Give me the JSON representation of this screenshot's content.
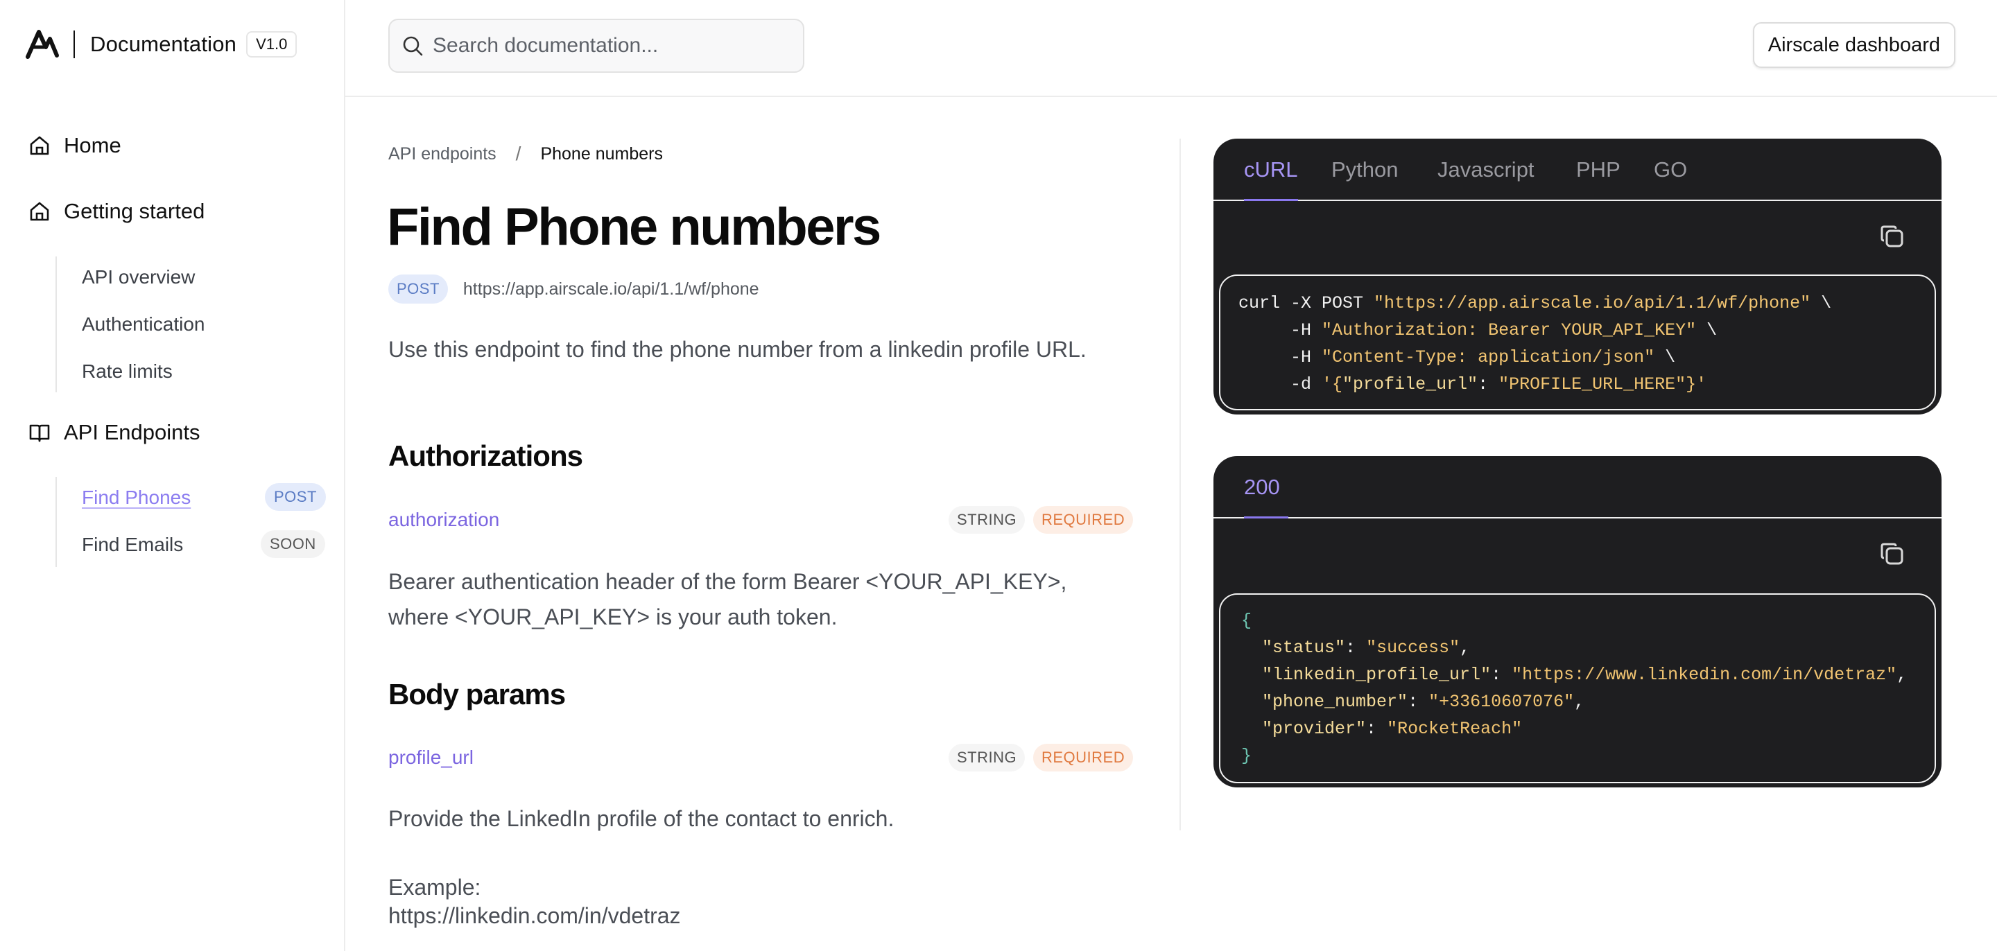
{
  "brand": {
    "title": "Documentation",
    "version": "V1.0"
  },
  "search": {
    "placeholder": "Search documentation..."
  },
  "topbar": {
    "dashboard_label": "Airscale dashboard"
  },
  "sidebar": {
    "home": "Home",
    "getting_started": "Getting started",
    "getting_started_items": [
      "API overview",
      "Authentication",
      "Rate limits"
    ],
    "api_endpoints": "API Endpoints",
    "endpoint_items": [
      {
        "label": "Find Phones",
        "badge": "POST",
        "active": true
      },
      {
        "label": "Find Emails",
        "badge": "SOON",
        "active": false
      }
    ]
  },
  "breadcrumb": {
    "parent": "API endpoints",
    "separator": "/",
    "current": "Phone numbers"
  },
  "page": {
    "title": "Find Phone numbers",
    "method": "POST",
    "url": "https://app.airscale.io/api/1.1/wf/phone",
    "description": "Use this endpoint to find the phone number from a linkedin profile URL."
  },
  "authorizations": {
    "heading": "Authorizations",
    "param": "authorization",
    "type": "STRING",
    "required": "REQUIRED",
    "description": "Bearer authentication header of the form Bearer <YOUR_API_KEY>, where <YOUR_API_KEY> is your auth token."
  },
  "body_params": {
    "heading": "Body params",
    "param": "profile_url",
    "type": "STRING",
    "required": "REQUIRED",
    "description": "Provide the LinkedIn profile of the contact to enrich.",
    "example_label": "Example:",
    "example_value": "https://linkedin.com/in/vdetraz"
  },
  "request_panel": {
    "tabs": [
      "cURL",
      "Python",
      "Javascript",
      "PHP",
      "GO"
    ],
    "active_tab": "cURL",
    "code": {
      "l1_cmd": "curl -X POST ",
      "l1_url": "\"https://app.airscale.io/api/1.1/wf/phone\"",
      "l1_cont": " \\",
      "l2_flag": "     -H ",
      "l2_val": "\"Authorization: Bearer YOUR_API_KEY\"",
      "l2_cont": " \\",
      "l3_flag": "     -H ",
      "l3_val": "\"Content-Type: application/json\"",
      "l3_cont": " \\",
      "l4_flag": "     -d ",
      "l4_open": "'{",
      "l4_key": "\"profile_url\"",
      "l4_colon": ": ",
      "l4_val": "\"PROFILE_URL_HERE\"",
      "l4_close": "}'"
    }
  },
  "response_panel": {
    "tabs": [
      "200"
    ],
    "active_tab": "200",
    "code": {
      "open": "{",
      "lines": [
        {
          "key": "\"status\"",
          "value": "\"success\"",
          "comma": ","
        },
        {
          "key": "\"linkedin_profile_url\"",
          "value": "\"https://www.linkedin.com/in/vdetraz\"",
          "comma": ","
        },
        {
          "key": "\"phone_number\"",
          "value": "\"+33610607076\"",
          "comma": ","
        },
        {
          "key": "\"provider\"",
          "value": "\"RocketReach\"",
          "comma": ""
        }
      ],
      "close": "}"
    }
  },
  "colors": {
    "accent": "#8b7cf0",
    "code_bg": "#1e1e20",
    "string": "#f2c572",
    "required": "#e0793f"
  }
}
